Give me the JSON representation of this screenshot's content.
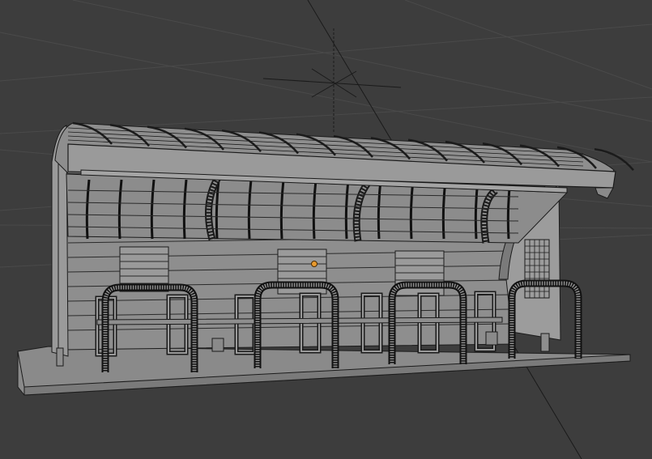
{
  "viewport": {
    "background": "#3d3d3d",
    "grid_color": "#4a4a4a",
    "mesh_fill": "#8e8e8e",
    "mesh_fill_light": "#9a9a9a",
    "mesh_fill_dark": "#7a7a7a",
    "wire_color": "#1b1b1b",
    "origin_color": "#e89a2e"
  },
  "scene": {
    "object": "bus-shelter-mesh",
    "shading": "solid-wireframe",
    "seat_groups": 3,
    "bike_racks": 4
  }
}
